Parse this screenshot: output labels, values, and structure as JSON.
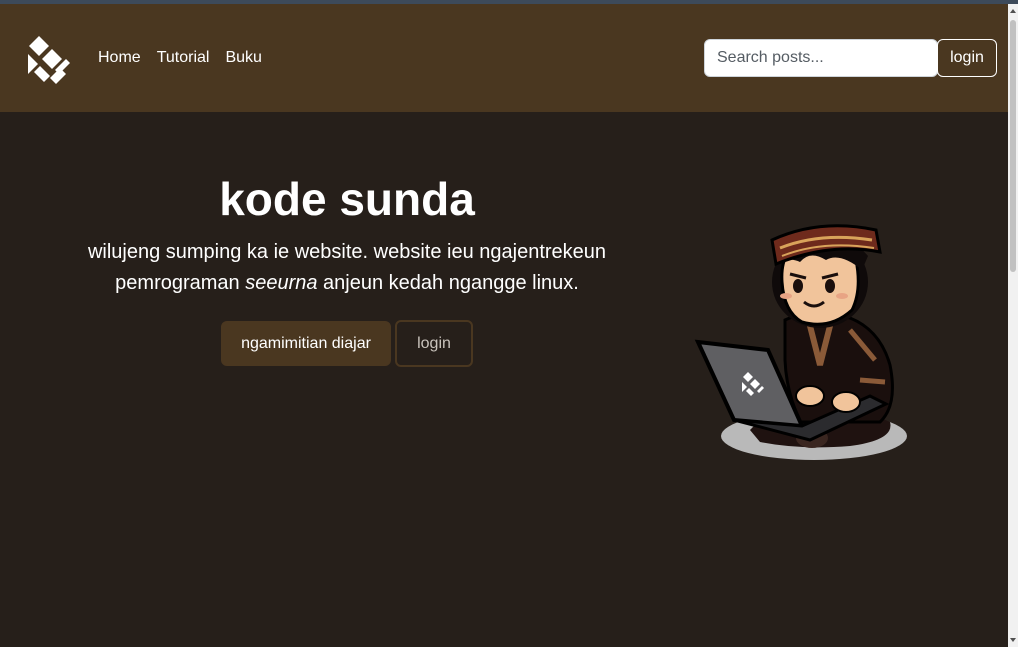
{
  "navbar": {
    "links": [
      "Home",
      "Tutorial",
      "Buku"
    ],
    "search_placeholder": "Search posts...",
    "login_label": "login",
    "logo_icon": "kode-sunda-logo-icon"
  },
  "hero": {
    "title": "kode sunda",
    "subtitle_part1": "wilujeng sumping ka ie website. website ieu ngajentrekeun pemrograman ",
    "subtitle_em": "seeurna",
    "subtitle_part2": " anjeun kedah ngangge linux.",
    "primary_button": "ngamimitian diajar",
    "secondary_button": "login",
    "illustration_icon": "developer-mascot-illustration"
  },
  "colors": {
    "background": "#261f1a",
    "navbar": "#4a3720",
    "accent": "#4a3720",
    "text": "#ffffff"
  }
}
